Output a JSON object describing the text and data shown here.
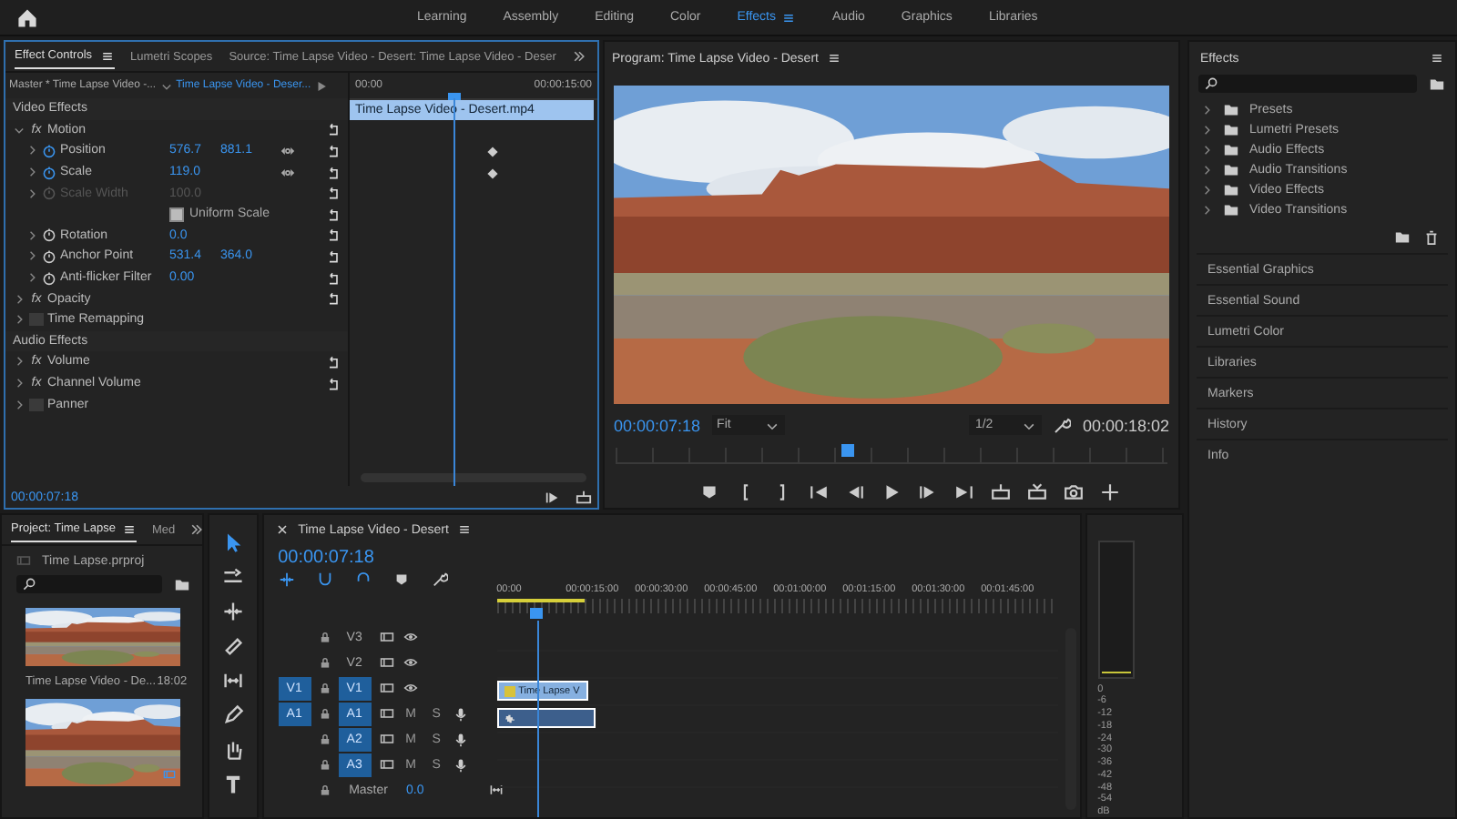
{
  "workspaces": [
    {
      "label": "Learning",
      "selected": false
    },
    {
      "label": "Assembly",
      "selected": false
    },
    {
      "label": "Editing",
      "selected": false
    },
    {
      "label": "Color",
      "selected": false
    },
    {
      "label": "Effects",
      "selected": true
    },
    {
      "label": "Audio",
      "selected": false
    },
    {
      "label": "Graphics",
      "selected": false
    },
    {
      "label": "Libraries",
      "selected": false
    }
  ],
  "effect_controls": {
    "tabs": [
      {
        "label": "Effect Controls",
        "selected": true
      },
      {
        "label": "Lumetri Scopes",
        "selected": false
      },
      {
        "label": "Source: Time Lapse Video - Desert: Time Lapse Video - Deser",
        "selected": false
      }
    ],
    "master_label": "Master * Time Lapse Video -...",
    "clip_selector": "Time Lapse Video - Deser...",
    "ruler": [
      "00:00",
      "00:00:15:00"
    ],
    "clip": "Time Lapse Video - Desert.mp4",
    "playhead": {
      "level": 0.42
    },
    "rows": [
      {
        "kind": "section",
        "label": "Video Effects"
      },
      {
        "kind": "effect",
        "label": "Motion",
        "badge": "fx",
        "expanded": true
      },
      {
        "kind": "property",
        "label": "Position",
        "expanded": false,
        "animated": true,
        "disabled": false,
        "values": [
          "576.7",
          "881.1"
        ]
      },
      {
        "kind": "property",
        "label": "Scale",
        "expanded": false,
        "animated": true,
        "disabled": false,
        "values": [
          "119.0"
        ]
      },
      {
        "kind": "property",
        "label": "Scale Width",
        "expanded": false,
        "animated": false,
        "disabled": true,
        "values": [
          "100.0"
        ]
      },
      {
        "kind": "checkbox",
        "label": "Uniform Scale",
        "checked": true
      },
      {
        "kind": "property",
        "label": "Rotation",
        "expanded": false,
        "animated": false,
        "disabled": false,
        "values": [
          "0.0"
        ]
      },
      {
        "kind": "property",
        "label": "Anchor Point",
        "expanded": false,
        "animated": false,
        "disabled": false,
        "values": [
          "531.4",
          "364.0"
        ]
      },
      {
        "kind": "property",
        "label": "Anti-flicker Filter",
        "expanded": false,
        "animated": false,
        "disabled": false,
        "values": [
          "0.00"
        ]
      },
      {
        "kind": "effect",
        "label": "Opacity",
        "badge": "fx",
        "expanded": false
      },
      {
        "kind": "effect",
        "label": "Time Remapping",
        "expanded": false
      },
      {
        "kind": "section",
        "label": "Audio Effects"
      },
      {
        "kind": "effect",
        "label": "Volume",
        "badge": "fx",
        "expanded": false
      },
      {
        "kind": "effect",
        "label": "Channel Volume",
        "badge": "fx",
        "expanded": false
      },
      {
        "kind": "effect",
        "label": "Panner",
        "expanded": false
      }
    ],
    "timecode": "00:00:07:18"
  },
  "program": {
    "title": "Program: Time Lapse Video - Desert",
    "timecode": "00:00:07:18",
    "fit": "Fit",
    "resolution": "1/2",
    "duration": "00:00:18:02",
    "scrubber": {
      "level": 0.42
    }
  },
  "effects_panel": {
    "title": "Effects",
    "tree": [
      {
        "label": "Presets",
        "expanded": false
      },
      {
        "label": "Lumetri Presets",
        "expanded": false
      },
      {
        "label": "Audio Effects",
        "expanded": false
      },
      {
        "label": "Audio Transitions",
        "expanded": false
      },
      {
        "label": "Video Effects",
        "expanded": false
      },
      {
        "label": "Video Transitions",
        "expanded": false
      }
    ],
    "panels": [
      "Essential Graphics",
      "Essential Sound",
      "Lumetri Color",
      "Libraries",
      "Markers",
      "History",
      "Info"
    ]
  },
  "project": {
    "tabs": [
      {
        "label": "Project: Time Lapse",
        "selected": true
      },
      {
        "label": "Med",
        "selected": false
      }
    ],
    "file": "Time Lapse.prproj",
    "items": [
      {
        "kind": "clip",
        "name": "Time Lapse Video - De...",
        "duration": "18:02"
      },
      {
        "kind": "sequence"
      }
    ]
  },
  "tools": [
    {
      "kind": "selection",
      "selected": true
    },
    {
      "kind": "track-select",
      "selected": false
    },
    {
      "kind": "ripple",
      "selected": false
    },
    {
      "kind": "razor",
      "selected": false
    },
    {
      "kind": "slip",
      "selected": false
    },
    {
      "kind": "pen",
      "selected": false
    },
    {
      "kind": "hand",
      "selected": false
    },
    {
      "kind": "type",
      "selected": false
    }
  ],
  "timeline": {
    "title": "Time Lapse Video - Desert",
    "timecode": "00:00:07:18",
    "ruler": [
      "00:00",
      "00:00:15:00",
      "00:00:30:00",
      "00:00:45:00",
      "00:01:00:00",
      "00:01:15:00",
      "00:01:30:00",
      "00:01:45:00"
    ],
    "playhead": {
      "level": 0.07
    },
    "tracks": [
      {
        "kind": "video",
        "label": "V3",
        "targeted": false
      },
      {
        "kind": "video",
        "label": "V2",
        "targeted": false
      },
      {
        "kind": "video",
        "source": "V1",
        "label": "V1",
        "targeted": true,
        "clip": {
          "label": "Time Lapse V",
          "selected": true
        }
      },
      {
        "kind": "audio",
        "source": "A1",
        "label": "A1",
        "targeted": true,
        "buttons": [
          "M",
          "S"
        ],
        "clip": {
          "selected": true
        }
      },
      {
        "kind": "audio",
        "label": "A2",
        "targeted": true,
        "buttons": [
          "M",
          "S"
        ]
      },
      {
        "kind": "audio",
        "label": "A3",
        "targeted": true,
        "buttons": [
          "M",
          "S"
        ]
      }
    ],
    "master": {
      "label": "Master",
      "value": "0.0"
    }
  },
  "meter": {
    "scale": [
      "0",
      "-6",
      "-12",
      "-18",
      "-24",
      "-30",
      "-36",
      "-42",
      "-48",
      "-54",
      "dB"
    ]
  }
}
